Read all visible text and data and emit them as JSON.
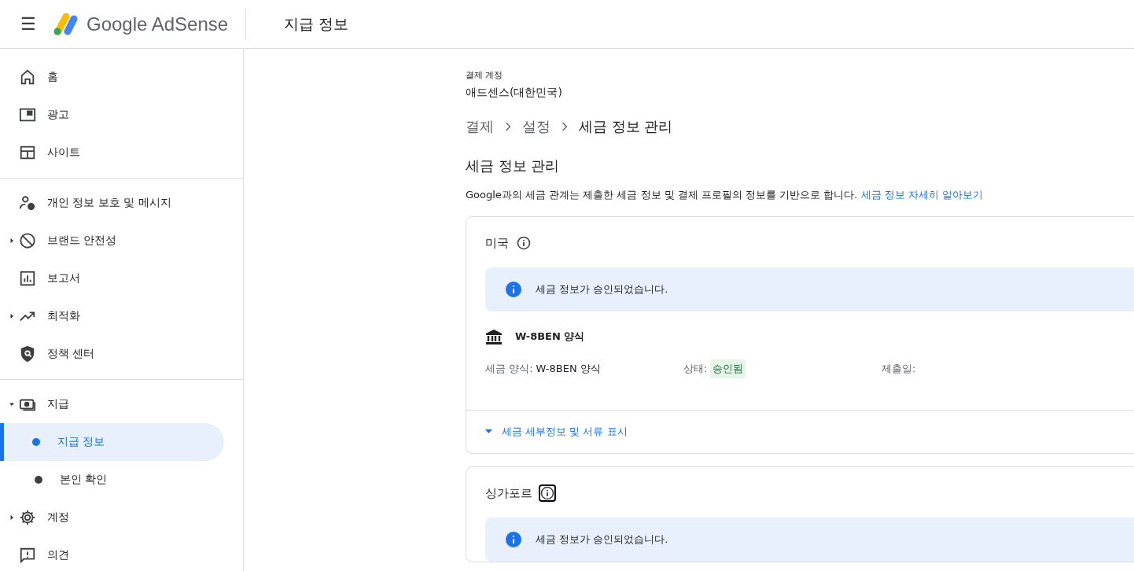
{
  "header": {
    "menu": "☰",
    "product": "Google AdSense",
    "title": "지급 정보"
  },
  "sidebar": {
    "sections": [
      [
        {
          "label": "홈"
        },
        {
          "label": "광고"
        },
        {
          "label": "사이트"
        }
      ],
      [
        {
          "label": "개인 정보 보호 및 메시지"
        },
        {
          "label": "브랜드 안전성",
          "expanded": false
        },
        {
          "label": "보고서"
        },
        {
          "label": "최적화",
          "expanded": false
        },
        {
          "label": "정책 센터"
        }
      ],
      [
        {
          "label": "지급",
          "expanded": true,
          "children": [
            {
              "label": "지급 정보",
              "selected": true
            },
            {
              "label": "본인 확인",
              "selected": false
            }
          ]
        },
        {
          "label": "계정",
          "expanded": false
        },
        {
          "label": "의견"
        }
      ]
    ]
  },
  "account": {
    "caption": "결제 계정",
    "name": "애드센스(대한민국)"
  },
  "breadcrumb": [
    "결제",
    "설정",
    "세금 정보 관리"
  ],
  "heading": "세금 정보 관리",
  "description": {
    "text": "Google과의 세금 관계는 제출한 세금 정보 및 결제 프로필의 정보를 기반으로 합니다.",
    "link": "세금 정보 자세히 알아보기"
  },
  "cards": [
    {
      "country": "미국",
      "focused": false,
      "notice": "세금 정보가 승인되었습니다.",
      "form": {
        "title": "W-8BEN 양식",
        "fields": [
          {
            "kind": "text",
            "label": "세금 양식:",
            "value": "W-8BEN 양식"
          },
          {
            "kind": "badge",
            "label": "상태:",
            "value": "승인됨"
          },
          {
            "kind": "text",
            "label": "제출일:"
          }
        ]
      },
      "expand_link": "세금 세부정보 및 서류 표시"
    },
    {
      "country": "싱가포르",
      "focused": true,
      "notice": "세금 정보가 승인되었습니다."
    }
  ]
}
